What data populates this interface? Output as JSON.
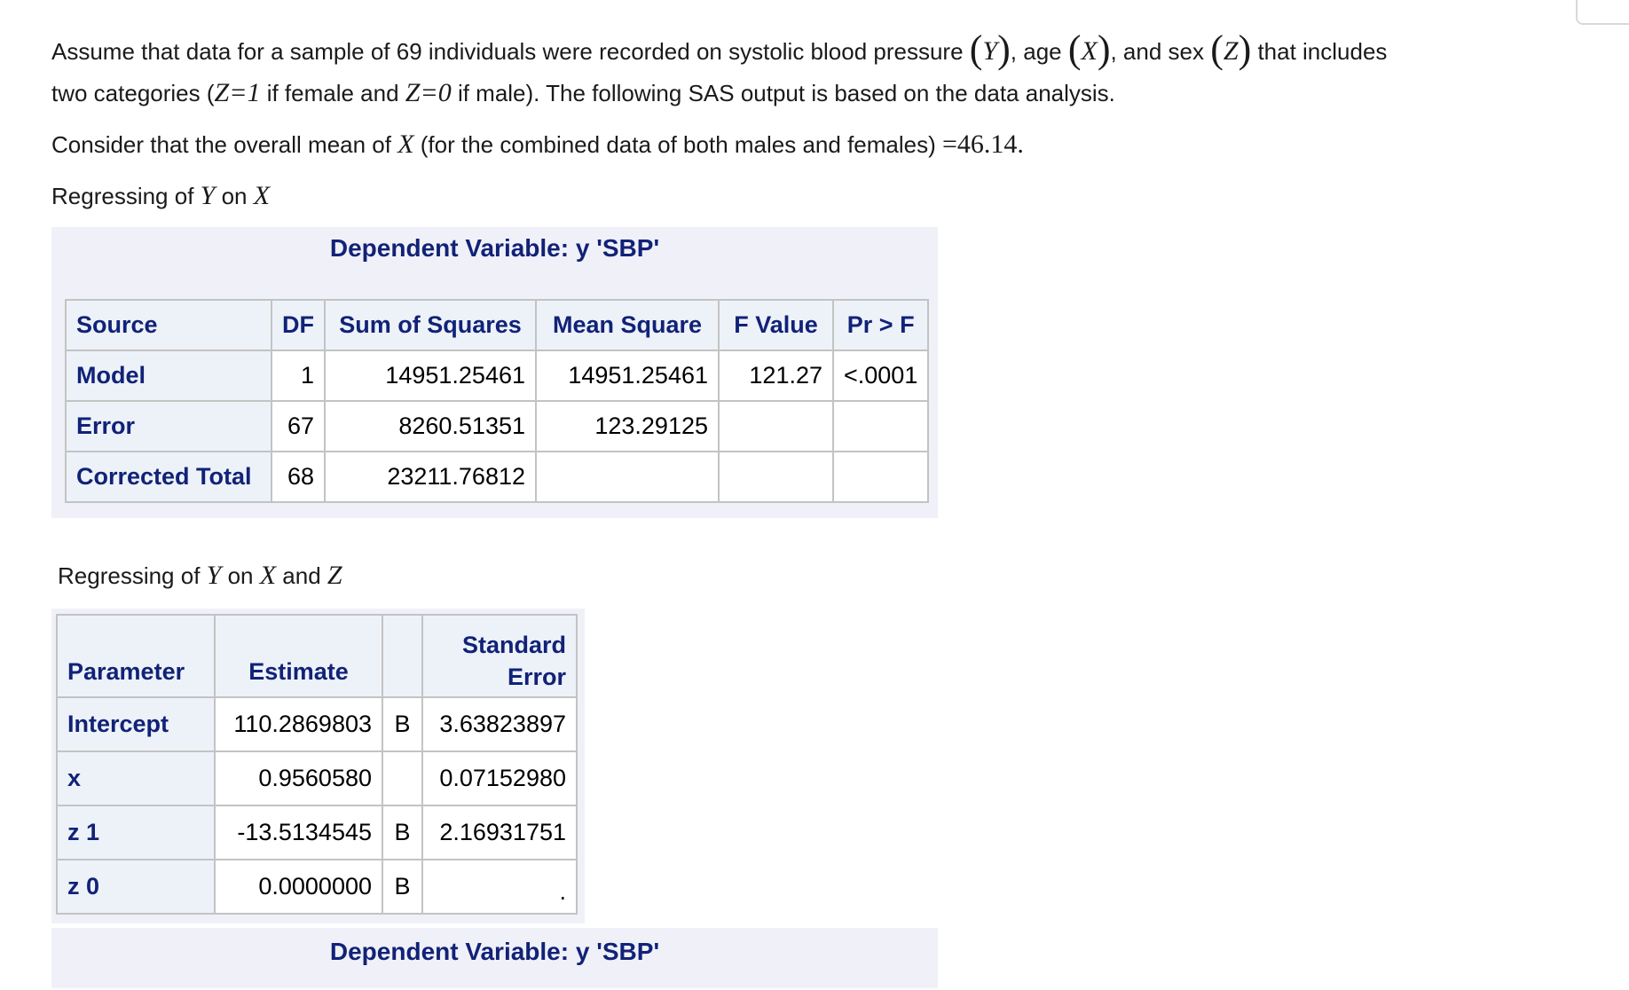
{
  "intro": {
    "line1_a": "Assume that data for a sample of 69 individuals were recorded on systolic blood pressure ",
    "sym_Y": "Y",
    "line1_b": ", age ",
    "sym_X": "X",
    "line1_c": ", and sex ",
    "sym_Z": "Z",
    "line1_d": " that includes",
    "line2_a": "two categories (",
    "z1_eq": "Z=1",
    "line2_b": " if female and ",
    "z0_eq": "Z=0",
    "line2_c": " if male). The following SAS output is based on the data analysis.",
    "line3_a": "Consider that the overall mean of ",
    "line3_b": " (for the combined data of both males and females) ",
    "mean_value": "=46.14."
  },
  "section1": {
    "heading_a": "Regressing of ",
    "heading_y": "Y",
    "heading_b": " on ",
    "heading_x": "X",
    "dependent_title": "Dependent Variable: y 'SBP'",
    "headers": [
      "Source",
      "DF",
      "Sum of Squares",
      "Mean Square",
      "F Value",
      "Pr > F"
    ],
    "rows": [
      {
        "source": "Model",
        "df": "1",
        "ss": "14951.25461",
        "ms": "14951.25461",
        "f": "121.27",
        "p": "<.0001"
      },
      {
        "source": "Error",
        "df": "67",
        "ss": "8260.51351",
        "ms": "123.29125",
        "f": "",
        "p": ""
      },
      {
        "source": "Corrected Total",
        "df": "68",
        "ss": "23211.76812",
        "ms": "",
        "f": "",
        "p": ""
      }
    ]
  },
  "section2": {
    "heading_a": "Regressing of ",
    "heading_y": "Y",
    "heading_b": " on ",
    "heading_x": "X",
    "heading_c": " and ",
    "heading_z": "Z",
    "headers": {
      "parameter": "Parameter",
      "estimate": "Estimate",
      "flag": "",
      "se_line1": "Standard",
      "se_line2": "Error"
    },
    "rows": [
      {
        "param": "Intercept",
        "estimate": "110.2869803",
        "flag": "B",
        "se": "3.63823897"
      },
      {
        "param": "x",
        "estimate": "0.9560580",
        "flag": "",
        "se": "0.07152980"
      },
      {
        "param": "z 1",
        "estimate": "-13.5134545",
        "flag": "B",
        "se": "2.16931751"
      },
      {
        "param": "z 0",
        "estimate": "0.0000000",
        "flag": "B",
        "se": "."
      }
    ],
    "dependent_title": "Dependent Variable: y 'SBP'"
  }
}
